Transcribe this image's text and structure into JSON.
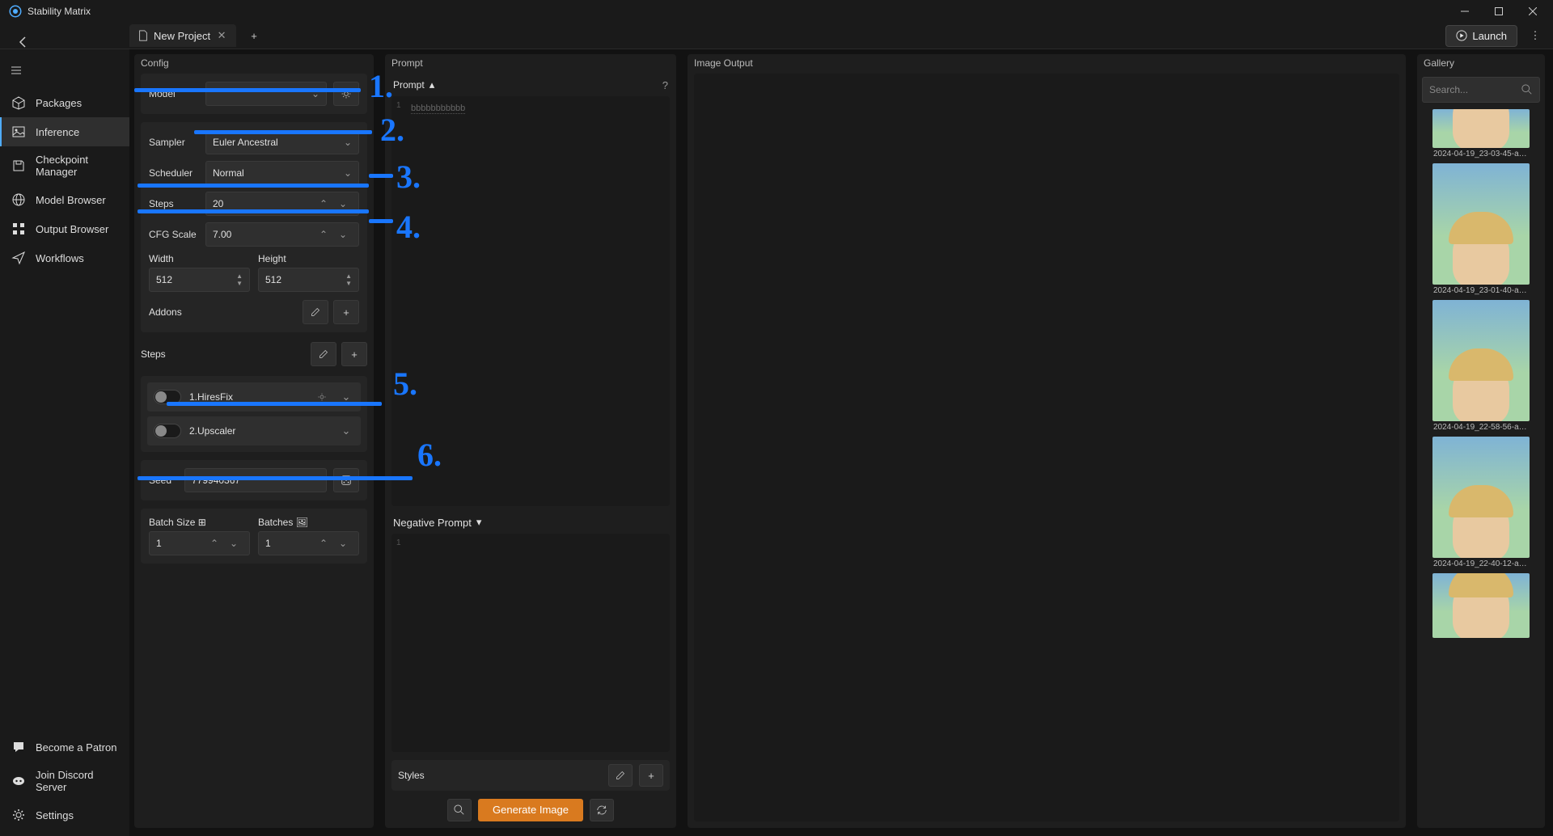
{
  "app_title": "Stability Matrix",
  "tab": {
    "title": "New Project"
  },
  "launch_label": "Launch",
  "sidebar": {
    "items": [
      {
        "label": "Packages",
        "icon": "box"
      },
      {
        "label": "Inference",
        "icon": "img",
        "active": true
      },
      {
        "label": "Checkpoint Manager",
        "icon": "save"
      },
      {
        "label": "Model Browser",
        "icon": "globe"
      },
      {
        "label": "Output Browser",
        "icon": "grid"
      },
      {
        "label": "Workflows",
        "icon": "send"
      }
    ],
    "bottom_items": [
      {
        "label": "Become a Patron",
        "icon": "chat"
      },
      {
        "label": "Join Discord Server",
        "icon": "discord"
      },
      {
        "label": "Settings",
        "icon": "gear"
      }
    ]
  },
  "config": {
    "header": "Config",
    "model_label": "Model",
    "model_value": "",
    "sampler_label": "Sampler",
    "sampler_value": "Euler Ancestral",
    "scheduler_label": "Scheduler",
    "scheduler_value": "Normal",
    "steps_label": "Steps",
    "steps_value": "20",
    "cfg_label": "CFG Scale",
    "cfg_value": "7.00",
    "width_label": "Width",
    "width_value": "512",
    "height_label": "Height",
    "height_value": "512",
    "addons_label": "Addons",
    "steps_section": "Steps",
    "hiresfix_label": "1.HiresFix",
    "upscaler_label": "2.Upscaler",
    "seed_label": "Seed",
    "seed_value": "779940367",
    "batch_size_label": "Batch Size",
    "batch_size_value": "1",
    "batches_label": "Batches",
    "batches_value": "1"
  },
  "prompt": {
    "header": "Prompt",
    "title": "Prompt",
    "placeholder": "bbbbbbbbbbb",
    "neg_title": "Negative Prompt",
    "styles_label": "Styles",
    "generate_label": "Generate Image"
  },
  "output": {
    "header": "Image Output"
  },
  "gallery": {
    "header": "Gallery",
    "search_placeholder": "Search...",
    "items": [
      {
        "caption": "2024-04-19_23-03-45-aut..."
      },
      {
        "caption": "2024-04-19_23-01-40-aut..."
      },
      {
        "caption": "2024-04-19_22-58-56-aut..."
      },
      {
        "caption": "2024-04-19_22-40-12-aut..."
      },
      {
        "caption": ""
      }
    ]
  },
  "annotations": [
    "1.",
    "2.",
    "3.",
    "4.",
    "5.",
    "6."
  ]
}
